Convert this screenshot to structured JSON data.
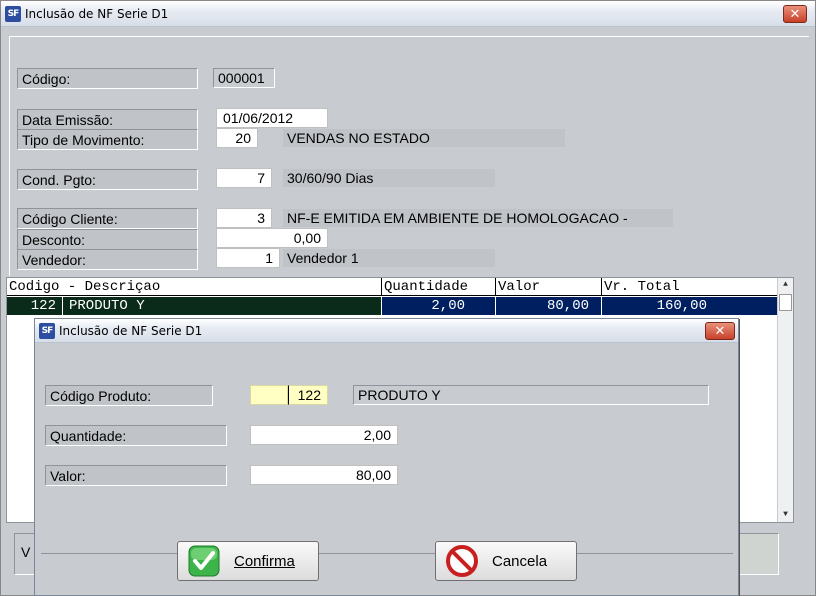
{
  "window": {
    "title": "Inclusão  de NF Serie D1",
    "icon_text": "SF",
    "close_label": "✕"
  },
  "form": {
    "codigo": {
      "label": "Código:",
      "value": "000001"
    },
    "data_emissao": {
      "label": "Data Emissão:",
      "value": "01/06/2012"
    },
    "tipo_movimento": {
      "label": "Tipo de Movimento:",
      "code": "20",
      "description": "VENDAS NO ESTADO"
    },
    "cond_pgto": {
      "label": "Cond. Pgto:",
      "code": "7",
      "description": "30/60/90 Dias"
    },
    "codigo_cliente": {
      "label": "Código Cliente:",
      "code": "3",
      "description": "NF-E EMITIDA EM AMBIENTE DE HOMOLOGACAO -"
    },
    "desconto": {
      "label": "Desconto:",
      "value": "0,00"
    },
    "vendedor": {
      "label": "Vendedor:",
      "code": "1",
      "description": "Vendedor 1"
    }
  },
  "grid": {
    "headers": [
      "Codigo - Descriçao",
      "Quantidade",
      "Valor",
      "Vr. Total"
    ],
    "rows": [
      {
        "codigo": "122",
        "descricao": "PRODUTO Y",
        "quantidade": "2,00",
        "valor": "80,00",
        "total": "160,00"
      }
    ],
    "selected_row_color": "#001f60",
    "first_cell_color": "#0a2a1a"
  },
  "bottom": {
    "left_text": "V"
  },
  "dialog": {
    "title": "Inclusão  de NF Serie D1",
    "icon_text": "SF",
    "close_label": "✕",
    "codigo_produto": {
      "label": "Código Produto:",
      "value": "122",
      "description": "PRODUTO Y"
    },
    "quantidade": {
      "label": "Quantidade:",
      "value": "2,00"
    },
    "valor": {
      "label": "Valor:",
      "value": "80,00"
    },
    "confirm_button": {
      "label": "Confirma",
      "icon": "green-check-icon"
    },
    "cancel_button": {
      "label": "Cancela",
      "icon": "red-prohibited-icon"
    }
  },
  "colors": {
    "window_bg": "#c8ccd0",
    "label_bg": "#c0c4c8",
    "selected_row": "#001f60",
    "close_button": "#c8412a"
  }
}
